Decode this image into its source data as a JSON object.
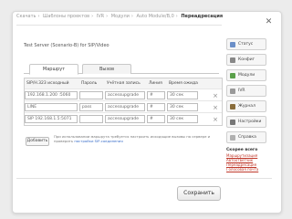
{
  "breadcrumb": [
    "Скачать",
    "Шаблоны проектов",
    "IVR",
    "Модули",
    "Auto Module/B,0",
    "Переадресация"
  ],
  "window": {
    "close_icon": "close-icon"
  },
  "main": {
    "file_label": "Test Server (Scenario-B) for SIP/Video",
    "tabs": [
      {
        "label": "Маршрут",
        "active": true
      },
      {
        "label": "Вызов",
        "active": false
      }
    ],
    "table": {
      "headers": [
        "SIP/H.323 исходный",
        "Пароль",
        "Учётная запись",
        "Линия",
        "Время ожидания"
      ],
      "rows": [
        [
          "192.168.1.200 :5060",
          "",
          "accessupgrade",
          "#",
          "30 сек"
        ],
        [
          "LINE",
          "pass",
          "accessupgrade",
          "#",
          "30 сек"
        ],
        [
          "SIP 192.168.1.5:5071",
          "",
          "accessupgrade",
          "#",
          "30 сек"
        ]
      ],
      "delete_symbol": "×"
    },
    "add_button": "Добавить",
    "note_text": "При использовании маршрута требуется настроить исходящие вызовы на сервере и проверить",
    "note_link": "настройки SIP-соединения"
  },
  "sidebar": {
    "buttons": [
      {
        "label": "Статус",
        "icon": "info-icon",
        "color": "#6b8fc8"
      },
      {
        "label": "Конфиг",
        "icon": "gear-icon",
        "color": "#888888"
      },
      {
        "label": "Модули",
        "icon": "puzzle-icon",
        "color": "#5aa04a"
      },
      {
        "label": "IVR",
        "icon": "phone-icon",
        "color": "#999999"
      },
      {
        "label": "Журнал",
        "icon": "log-icon",
        "color": "#8a6d3b"
      },
      {
        "label": "Настройки",
        "icon": "wrench-icon",
        "color": "#777777"
      },
      {
        "label": "Справка",
        "icon": "help-icon",
        "color": "#b0b0b0"
      }
    ],
    "recent_title": "Скорее всего",
    "recent_links": [
      "Маршрутизация",
      "Автоответчик",
      "Переадресация",
      "Голосовая почта"
    ]
  },
  "footer": {
    "save_label": "Сохранить"
  },
  "colors": {
    "link": "#3a6ec9",
    "recent_link": "#c0392b"
  }
}
